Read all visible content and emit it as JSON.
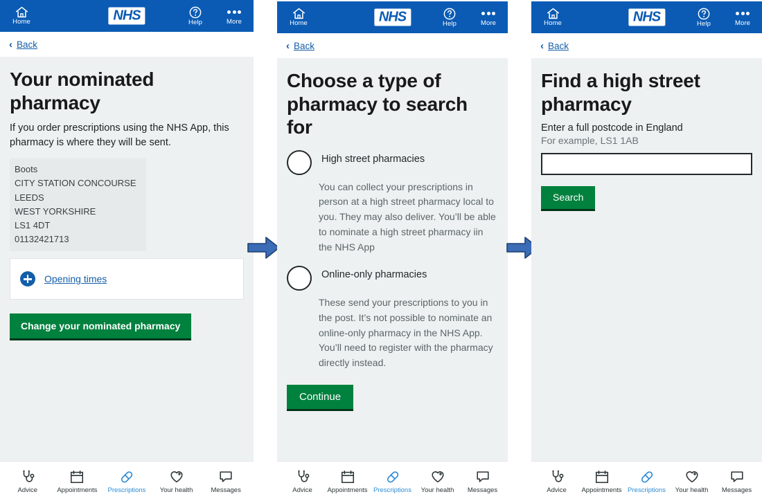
{
  "header": {
    "home_label": "Home",
    "home_icon": "home-icon",
    "logo_text": "NHS",
    "help_label": "Help",
    "help_icon": "question-circle-icon",
    "more_label": "More",
    "more_icon": "ellipsis-icon",
    "bg_color": "#0b5bb5"
  },
  "back": {
    "label": "Back",
    "chevron": "‹"
  },
  "bottom_nav": {
    "items": [
      {
        "label": "Advice",
        "icon": "stethoscope-icon",
        "active": false
      },
      {
        "label": "Appointments",
        "icon": "calendar-icon",
        "active": false
      },
      {
        "label": "Prescriptions",
        "icon": "pill-icon",
        "active": true
      },
      {
        "label": "Your health",
        "icon": "heart-plus-icon",
        "active": false
      },
      {
        "label": "Messages",
        "icon": "speech-bubble-icon",
        "active": false
      }
    ],
    "active_color": "#2d8bd4"
  },
  "screen1": {
    "title": "Your nominated pharmacy",
    "lede": "If you order prescriptions using the NHS App, this pharmacy is where they will be sent.",
    "address": [
      "Boots",
      "CITY STATION CONCOURSE",
      "LEEDS",
      "WEST YORKSHIRE",
      "LS1 4DT",
      "01132421713"
    ],
    "opening_times_label": "Opening times",
    "opening_times_icon": "plus-circle-icon",
    "change_button": "Change your nominated pharmacy"
  },
  "screen2": {
    "title": "Choose a type of pharmacy to search for",
    "options": [
      {
        "label": "High street pharmacies",
        "hint": "You can collect your prescriptions in person at a high street pharmacy local to you. They may also deliver. You’ll be able to nominate a high street pharmacy iin the NHS App",
        "selected": false
      },
      {
        "label": "Online-only pharmacies",
        "hint": "These send your prescriptions to you in the post. It’s not possible to nominate an online-only pharmacy in the NHS App. You’ll need to register with the pharmacy directly instead.",
        "selected": false
      }
    ],
    "continue_button": "Continue"
  },
  "screen3": {
    "title": "Find a high street pharmacy",
    "field_label": "Enter a full postcode in England",
    "field_hint": "For example, LS1 1AB",
    "field_value": "",
    "field_placeholder": "",
    "search_button": "Search"
  },
  "flow": {
    "arrow_icon": "right-arrow-icon",
    "arrow_color": "#3b6cb5"
  },
  "colors": {
    "nhs_blue": "#0b5bb5",
    "nhs_green": "#00813e",
    "link_blue": "#145ea8",
    "page_bg": "#eef1f1"
  }
}
